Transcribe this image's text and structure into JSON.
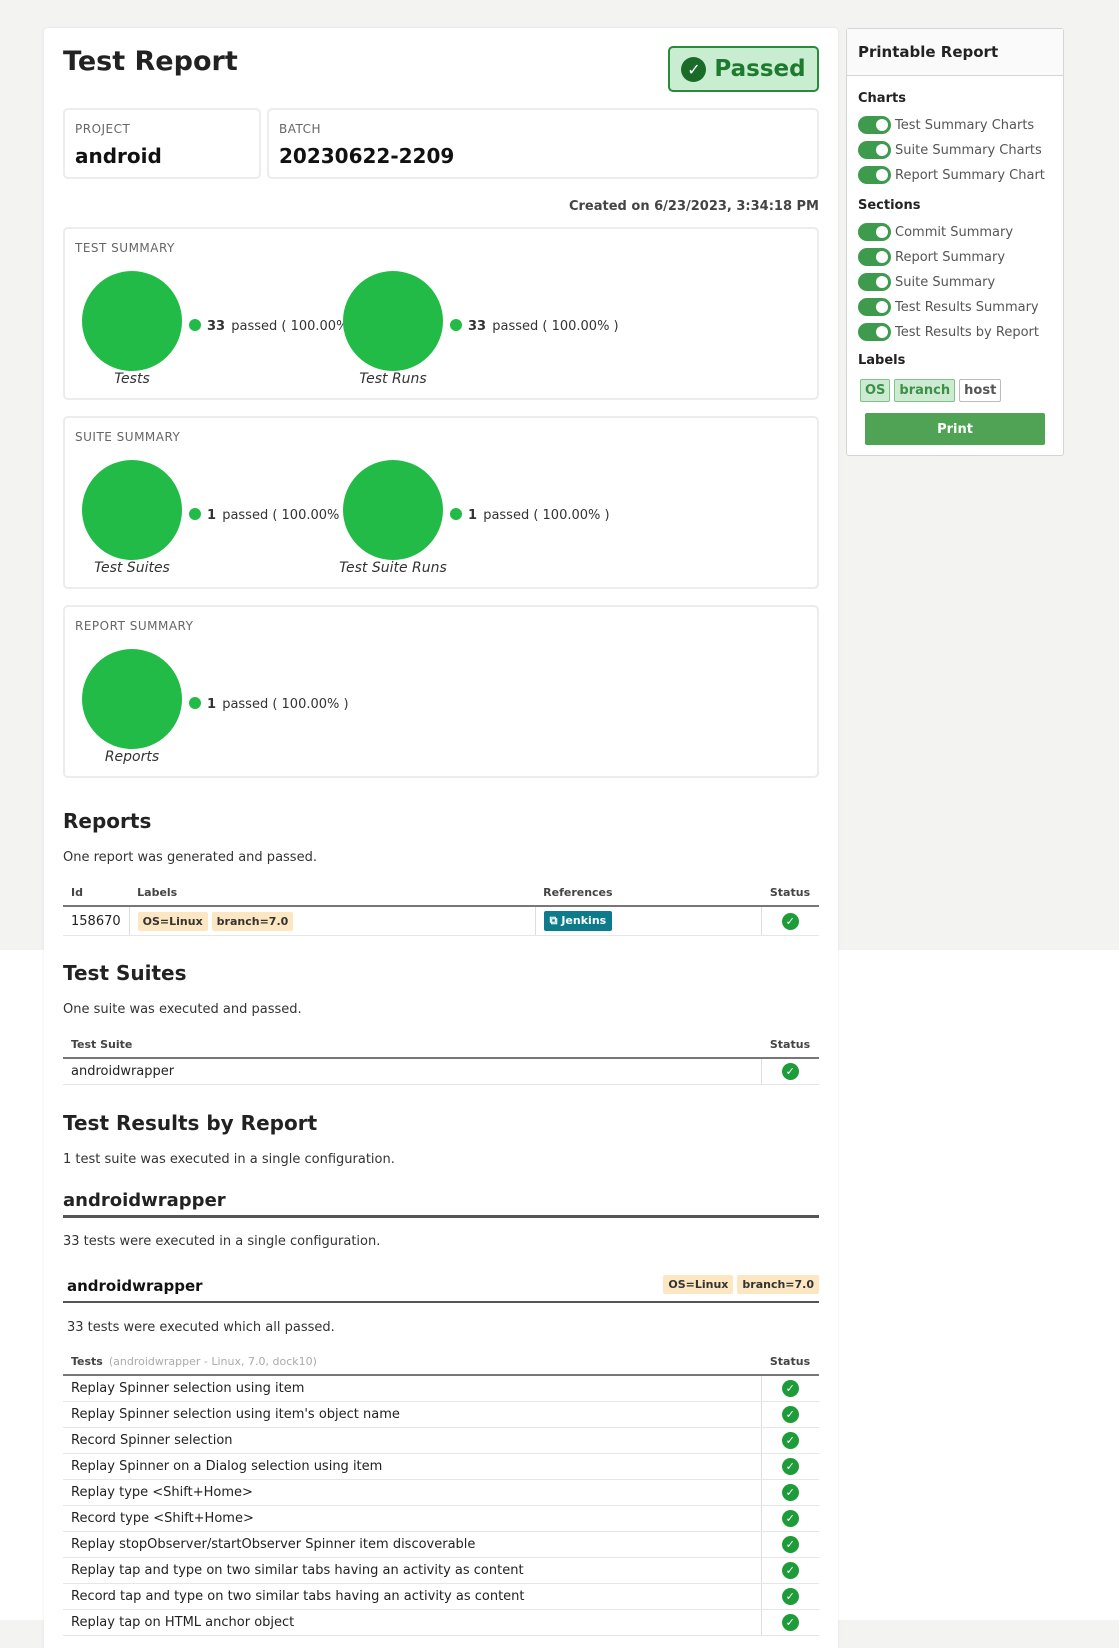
{
  "report": {
    "title": "Test Report",
    "status": "Passed",
    "project_label": "PROJECT",
    "project": "android",
    "batch_label": "BATCH",
    "batch": "20230622-2209",
    "created": "Created on 6/23/2023, 3:34:18 PM"
  },
  "summaries": {
    "test": {
      "label": "TEST SUMMARY",
      "groups": [
        {
          "caption": "Tests",
          "count": "33",
          "text": "passed ( 100.00% )"
        },
        {
          "caption": "Test Runs",
          "count": "33",
          "text": "passed ( 100.00% )"
        }
      ]
    },
    "suite": {
      "label": "SUITE SUMMARY",
      "groups": [
        {
          "caption": "Test Suites",
          "count": "1",
          "text": "passed ( 100.00% )"
        },
        {
          "caption": "Test Suite Runs",
          "count": "1",
          "text": "passed ( 100.00% )"
        }
      ]
    },
    "report": {
      "label": "REPORT SUMMARY",
      "groups": [
        {
          "caption": "Reports",
          "count": "1",
          "text": "passed ( 100.00% )"
        }
      ]
    }
  },
  "reports_section": {
    "heading": "Reports",
    "text": "One report was generated and passed.",
    "columns": {
      "id": "Id",
      "labels": "Labels",
      "references": "References",
      "status": "Status"
    },
    "row": {
      "id": "158670",
      "tag1": "OS=Linux",
      "tag2": "branch=7.0",
      "reference": "Jenkins"
    }
  },
  "suites_section": {
    "heading": "Test Suites",
    "text": "One suite was executed and passed.",
    "columns": {
      "suite": "Test Suite",
      "status": "Status"
    },
    "row": {
      "suite": "androidwrapper"
    }
  },
  "results_section": {
    "heading": "Test Results by Report",
    "text": "1 test suite was executed in a single configuration.",
    "suite_heading": "androidwrapper",
    "suite_text": "33 tests were executed in a single configuration.",
    "config_name": "androidwrapper",
    "config_tag1": "OS=Linux",
    "config_tag2": "branch=7.0",
    "config_text": "33 tests were executed which all passed.",
    "tests_col": "Tests",
    "tests_col_sub": "(androidwrapper - Linux, 7.0, dock10)",
    "status_col": "Status",
    "tests": [
      "Replay Spinner selection using item",
      "Replay Spinner selection using item's object name",
      "Record Spinner selection",
      "Replay Spinner on a Dialog selection using item",
      "Replay type <Shift+Home>",
      "Record type <Shift+Home>",
      "Replay stopObserver/startObserver Spinner item discoverable",
      "Replay tap and type on two similar tabs having an activity as content",
      "Record tap and type on two similar tabs having an activity as content",
      "Replay tap on HTML anchor object"
    ]
  },
  "sidebar": {
    "title": "Printable Report",
    "charts_label": "Charts",
    "charts": [
      "Test Summary Charts",
      "Suite Summary Charts",
      "Report Summary Chart"
    ],
    "sections_label": "Sections",
    "sections": [
      "Commit Summary",
      "Report Summary",
      "Suite Summary",
      "Test Results Summary",
      "Test Results by Report"
    ],
    "labels_label": "Labels",
    "labels": [
      "OS",
      "branch",
      "host"
    ],
    "print": "Print"
  },
  "colors": {
    "pass_green": "#23bb48",
    "status_bg": "#c9edd0",
    "tag_bg": "#fde6c2",
    "reference_bg": "#0e7b8c",
    "print_btn": "#50a355"
  },
  "icons": {
    "status": "check-circle-icon",
    "reference": "external-link-icon",
    "legend": "dot-icon"
  }
}
